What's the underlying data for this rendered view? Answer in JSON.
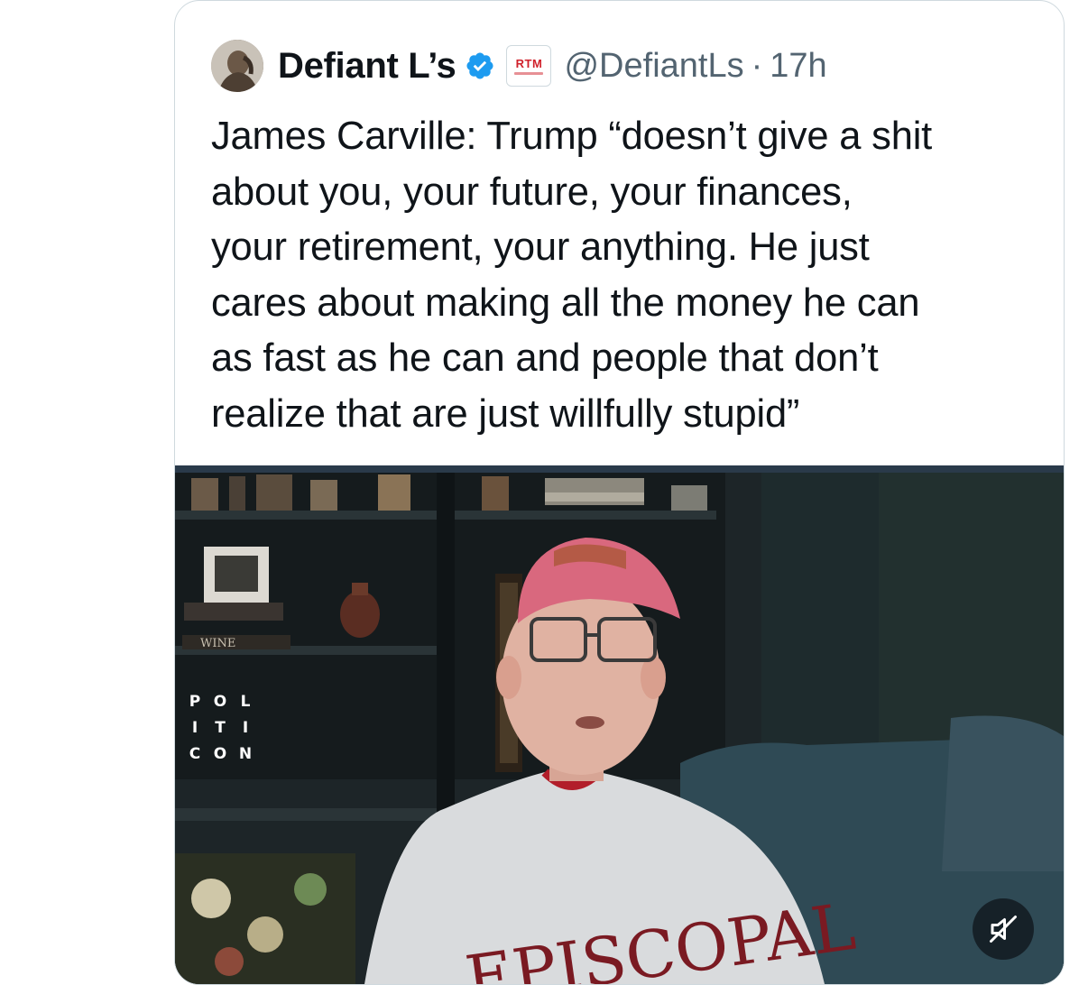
{
  "tweet": {
    "author_name": "Defiant L’s",
    "affiliate_badge": "RTM",
    "handle": "@DefiantLs",
    "separator": "·",
    "time": "17h",
    "text": "James Carville: Trump “doesn’t give a shit\nabout you, your future, your finances,\nyour retirement, your anything. He just\ncares about making all the money he can\nas fast as he can and people that don’t\nrealize that are just willfully stupid”"
  },
  "video": {
    "watermark_rows": [
      [
        "P",
        "O",
        "L"
      ],
      [
        "I",
        "T",
        "I"
      ],
      [
        "C",
        "O",
        "N"
      ]
    ],
    "shelf_label": "WINE",
    "sweatshirt_text": "EPISCOPAL"
  },
  "icons": {
    "verified": "verified-badge-icon",
    "mute": "muted-speaker-icon"
  },
  "colors": {
    "verified_blue": "#1d9bf0",
    "secondary_text": "#536471",
    "border": "#cfd9de"
  }
}
